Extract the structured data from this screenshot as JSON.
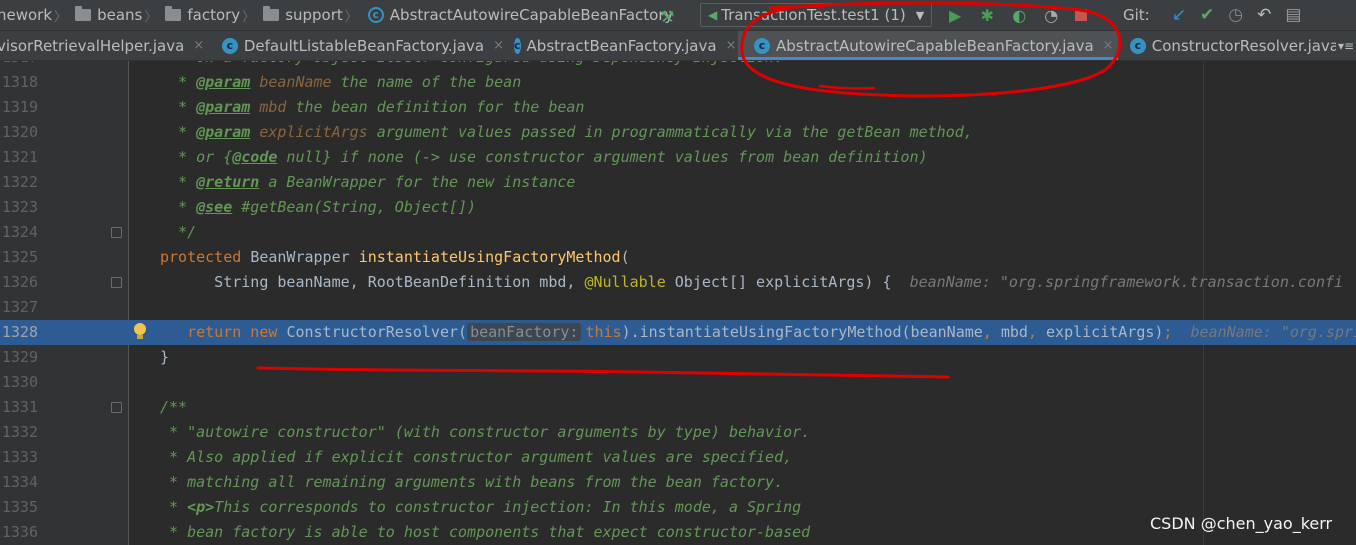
{
  "breadcrumb": [
    {
      "label": "nework",
      "icon": null
    },
    {
      "label": "beans",
      "icon": "folder-icon"
    },
    {
      "label": "factory",
      "icon": "folder-icon"
    },
    {
      "label": "support",
      "icon": "folder-icon"
    },
    {
      "label": "AbstractAutowireCapableBeanFactory",
      "icon": "class-icon"
    }
  ],
  "run": {
    "config_label": "TransactionTest.test1 (1)",
    "buttons": [
      "build-hammer-icon",
      "run-icon",
      "debug-icon",
      "run-with-coverage-icon",
      "profile-icon",
      "stop-icon"
    ]
  },
  "git": {
    "label": "Git:",
    "buttons": [
      "update-project-icon",
      "commit-icon",
      "history-icon",
      "rollback-icon",
      "project-structure-icon"
    ]
  },
  "tabs": [
    {
      "label": "visorRetrievalHelper.java",
      "icon": null,
      "active": false
    },
    {
      "label": "DefaultListableBeanFactory.java",
      "icon": "class-icon",
      "active": false
    },
    {
      "label": "AbstractBeanFactory.java",
      "icon": "class-icon",
      "active": false
    },
    {
      "label": "AbstractAutowireCapableBeanFactory.java",
      "icon": "class-icon",
      "active": true
    },
    {
      "label": "ConstructorResolver.java",
      "icon": "class-icon",
      "active": false
    }
  ],
  "tab_close_glyph": "×",
  "tab_overflow_glyph": "▾≡",
  "editor": {
    "highlighted_line": 1328,
    "lines": [
      {
        "n": 1317,
        "segs": [
          [
            "doc",
            "* on a factory object itself configured using Dependency Injection."
          ]
        ]
      },
      {
        "n": 1318,
        "segs": [
          [
            "doc",
            "* "
          ],
          [
            "tag",
            "@param"
          ],
          [
            "doc",
            " "
          ],
          [
            "pname",
            "beanName"
          ],
          [
            "doc",
            " the name of the bean"
          ]
        ]
      },
      {
        "n": 1319,
        "segs": [
          [
            "doc",
            "* "
          ],
          [
            "tag",
            "@param"
          ],
          [
            "doc",
            " "
          ],
          [
            "pname",
            "mbd"
          ],
          [
            "doc",
            " the bean definition for the bean"
          ]
        ]
      },
      {
        "n": 1320,
        "segs": [
          [
            "doc",
            "* "
          ],
          [
            "tag",
            "@param"
          ],
          [
            "doc",
            " "
          ],
          [
            "pname",
            "explicitArgs"
          ],
          [
            "doc",
            " argument values passed in programmatically via the getBean method,"
          ]
        ]
      },
      {
        "n": 1321,
        "segs": [
          [
            "doc",
            "* or {"
          ],
          [
            "tag",
            "@code"
          ],
          [
            "doc",
            " null} if none (-> use constructor argument values from bean definition)"
          ]
        ]
      },
      {
        "n": 1322,
        "segs": [
          [
            "doc",
            "* "
          ],
          [
            "tag",
            "@return"
          ],
          [
            "doc",
            " a BeanWrapper for the new instance"
          ]
        ]
      },
      {
        "n": 1323,
        "segs": [
          [
            "doc",
            "* "
          ],
          [
            "tag",
            "@see"
          ],
          [
            "doc",
            " #getBean(String, Object[])"
          ]
        ]
      },
      {
        "n": 1324,
        "fold": true,
        "segs": [
          [
            "doc",
            "*/"
          ]
        ]
      },
      {
        "n": 1325,
        "segs": [
          [
            "kw",
            "protected "
          ],
          [
            "plain",
            "BeanWrapper "
          ],
          [
            "fn",
            "instantiateUsingFactoryMethod"
          ],
          [
            "plain",
            "("
          ]
        ]
      },
      {
        "n": 1326,
        "fold": true,
        "segs": [
          [
            "plain",
            "      String beanName, RootBeanDefinition mbd, "
          ],
          [
            "ann",
            "@Nullable"
          ],
          [
            "plain",
            " Object[] explicitArgs) {  "
          ],
          [
            "hint",
            "beanName: \"org.springframework.transaction.confi"
          ]
        ]
      },
      {
        "n": 1327,
        "segs": []
      },
      {
        "n": 1328,
        "bulb": true,
        "segs": [
          [
            "plain",
            "   "
          ],
          [
            "kw",
            "return new "
          ],
          [
            "plain",
            "ConstructorResolver("
          ],
          [
            "phint",
            "beanFactory:"
          ],
          [
            "kw",
            "this"
          ],
          [
            "plain",
            ").instantiateUsingFactoryMethod(beanName"
          ],
          [
            "kw",
            ", "
          ],
          [
            "plain",
            "mbd"
          ],
          [
            "kw",
            ", "
          ],
          [
            "plain",
            "explicitArgs)"
          ],
          [
            "kw",
            ";"
          ],
          [
            "plain",
            "  "
          ],
          [
            "hint",
            "beanName: \"org.spri"
          ]
        ]
      },
      {
        "n": 1329,
        "segs": [
          [
            "plain",
            "}"
          ]
        ]
      },
      {
        "n": 1330,
        "segs": []
      },
      {
        "n": 1331,
        "fold": true,
        "segs": [
          [
            "doc",
            "/**"
          ]
        ]
      },
      {
        "n": 1332,
        "segs": [
          [
            "doc",
            " * \"autowire constructor\" (with constructor arguments by type) behavior."
          ]
        ]
      },
      {
        "n": 1333,
        "segs": [
          [
            "doc",
            " * Also applied if explicit constructor argument values are specified,"
          ]
        ]
      },
      {
        "n": 1334,
        "segs": [
          [
            "doc",
            " * matching all remaining arguments with beans from the bean factory."
          ]
        ]
      },
      {
        "n": 1335,
        "segs": [
          [
            "doc",
            " * "
          ],
          [
            "tag-nou",
            "<p>"
          ],
          [
            "doc",
            "This corresponds to constructor injection: In this mode, a Spring"
          ]
        ]
      },
      {
        "n": 1336,
        "segs": [
          [
            "doc",
            " * bean factory is able to host components that expect constructor-based"
          ]
        ]
      }
    ]
  },
  "watermark": "CSDN @chen_yao_kerr",
  "colors": {
    "annotation_red": "#e00000",
    "selection_blue": "#2d5c94",
    "keyword": "#cc7832",
    "doc_comment": "#629755"
  }
}
